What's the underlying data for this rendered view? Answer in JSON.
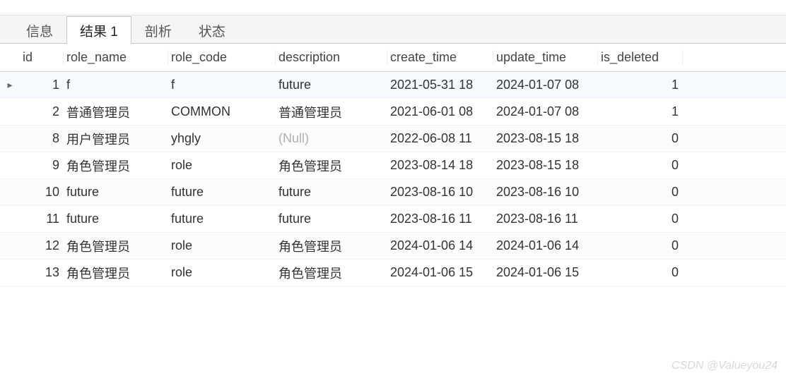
{
  "tabs": [
    {
      "label": "信息",
      "active": false
    },
    {
      "label": "结果 1",
      "active": true
    },
    {
      "label": "剖析",
      "active": false
    },
    {
      "label": "状态",
      "active": false
    }
  ],
  "columns": {
    "id": "id",
    "role_name": "role_name",
    "role_code": "role_code",
    "description": "description",
    "create_time": "create_time",
    "update_time": "update_time",
    "is_deleted": "is_deleted"
  },
  "null_label": "(Null)",
  "rows": [
    {
      "selected": true,
      "id": "1",
      "role_name": "f",
      "role_code": "f",
      "description": "future",
      "create_time": "2021-05-31 18",
      "update_time": "2024-01-07 08",
      "is_deleted": "1"
    },
    {
      "selected": false,
      "id": "2",
      "role_name": "普通管理员",
      "role_code": "COMMON",
      "description": "普通管理员",
      "create_time": "2021-06-01 08",
      "update_time": "2024-01-07 08",
      "is_deleted": "1"
    },
    {
      "selected": false,
      "id": "8",
      "role_name": "用户管理员",
      "role_code": "yhgly",
      "description": null,
      "create_time": "2022-06-08 11",
      "update_time": "2023-08-15 18",
      "is_deleted": "0"
    },
    {
      "selected": false,
      "id": "9",
      "role_name": "角色管理员",
      "role_code": "role",
      "description": "角色管理员",
      "create_time": "2023-08-14 18",
      "update_time": "2023-08-15 18",
      "is_deleted": "0"
    },
    {
      "selected": false,
      "id": "10",
      "role_name": "future",
      "role_code": "future",
      "description": "future",
      "create_time": "2023-08-16 10",
      "update_time": "2023-08-16 10",
      "is_deleted": "0"
    },
    {
      "selected": false,
      "id": "11",
      "role_name": "future",
      "role_code": "future",
      "description": "future",
      "create_time": "2023-08-16 11",
      "update_time": "2023-08-16 11",
      "is_deleted": "0"
    },
    {
      "selected": false,
      "id": "12",
      "role_name": "角色管理员",
      "role_code": "role",
      "description": "角色管理员",
      "create_time": "2024-01-06 14",
      "update_time": "2024-01-06 14",
      "is_deleted": "0"
    },
    {
      "selected": false,
      "id": "13",
      "role_name": "角色管理员",
      "role_code": "role",
      "description": "角色管理员",
      "create_time": "2024-01-06 15",
      "update_time": "2024-01-06 15",
      "is_deleted": "0"
    }
  ],
  "watermark": "CSDN @Valueyou24"
}
